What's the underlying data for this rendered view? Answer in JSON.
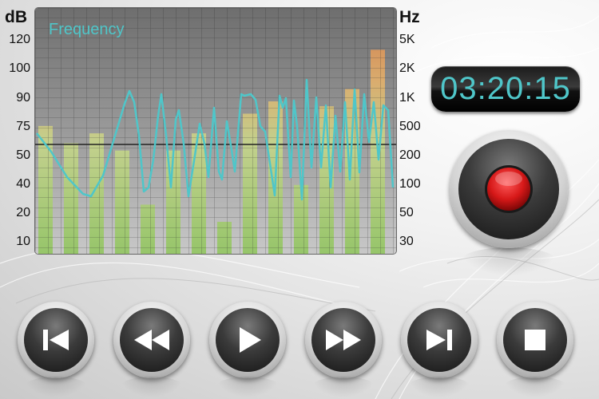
{
  "eq": {
    "title": "Frequency",
    "db_label": "dB",
    "hz_label": "Hz",
    "db_ticks": [
      "120",
      "100",
      "90",
      "75",
      "50",
      "40",
      "20",
      "10"
    ],
    "hz_ticks": [
      "5K",
      "2K",
      "1K",
      "500",
      "200",
      "100",
      "50",
      "30"
    ],
    "levels": [
      0.52,
      0.45,
      0.49,
      0.42,
      0.2,
      0.42,
      0.49,
      0.13,
      0.57,
      0.62,
      0.28,
      0.6,
      0.67,
      0.83,
      0.72
    ]
  },
  "recorder": {
    "elapsed_time": "03:20:15",
    "record_label": "Record"
  },
  "controls": [
    {
      "name": "skip-back",
      "icon": "skip-back-icon"
    },
    {
      "name": "rewind",
      "icon": "rewind-icon"
    },
    {
      "name": "play",
      "icon": "play-icon"
    },
    {
      "name": "fast-forward",
      "icon": "fast-forward-icon"
    },
    {
      "name": "skip-forward",
      "icon": "skip-forward-icon"
    },
    {
      "name": "stop",
      "icon": "stop-icon"
    }
  ],
  "colors": {
    "accent_cyan": "#4fc6c9",
    "record_red": "#d61818",
    "bar_green": "#a8cf7a",
    "bar_orange": "#e6884f"
  }
}
